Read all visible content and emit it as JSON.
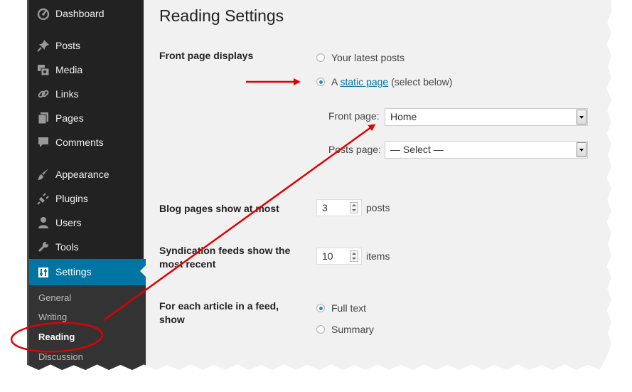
{
  "sidebar": {
    "items": [
      {
        "label": "Dashboard",
        "icon": "dashboard-icon"
      },
      {
        "label": "Posts",
        "icon": "pin-icon"
      },
      {
        "label": "Media",
        "icon": "media-icon"
      },
      {
        "label": "Links",
        "icon": "link-icon"
      },
      {
        "label": "Pages",
        "icon": "pages-icon"
      },
      {
        "label": "Comments",
        "icon": "comment-icon"
      },
      {
        "label": "Appearance",
        "icon": "brush-icon"
      },
      {
        "label": "Plugins",
        "icon": "plug-icon"
      },
      {
        "label": "Users",
        "icon": "user-icon"
      },
      {
        "label": "Tools",
        "icon": "wrench-icon"
      },
      {
        "label": "Settings",
        "icon": "settings-icon",
        "active": true
      }
    ],
    "submenu": [
      "General",
      "Writing",
      "Reading",
      "Discussion"
    ],
    "current_submenu": "Reading"
  },
  "main": {
    "title": "Reading Settings",
    "front_page": {
      "label": "Front page displays",
      "option_latest": "Your latest posts",
      "option_static_prefix": "A",
      "option_static_link": "static page",
      "option_static_suffix": "(select below)",
      "selected": "static",
      "front_page_label": "Front page:",
      "front_page_value": "Home",
      "posts_page_label": "Posts page:",
      "posts_page_value": "— Select —"
    },
    "blog_pages": {
      "label": "Blog pages show at most",
      "value": "3",
      "suffix": "posts"
    },
    "syndication": {
      "label": "Syndication feeds show the most recent",
      "value": "10",
      "suffix": "items"
    },
    "feed_article": {
      "label": "For each article in a feed, show",
      "option_full": "Full text",
      "option_summary": "Summary",
      "selected": "full"
    }
  },
  "colors": {
    "sidebar_bg": "#222222",
    "active_bg": "#0074a2",
    "content_bg": "#f1f1f1",
    "annotation": "#e00000"
  }
}
